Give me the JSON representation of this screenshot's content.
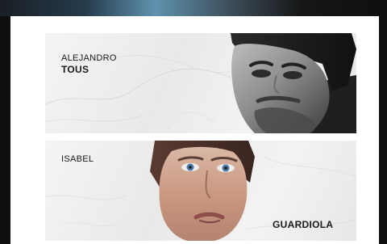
{
  "cards": [
    {
      "first_name": "ALEJANDRO",
      "last_name": "TOUS"
    },
    {
      "first_name": "ISABEL",
      "last_name": "GUARDIOLA"
    }
  ],
  "colors": {
    "background": "#0f0f10",
    "sheet": "#ffffff",
    "card": "#efefef",
    "text": "#1a1a1a",
    "accent_top": "#5f92ad"
  }
}
